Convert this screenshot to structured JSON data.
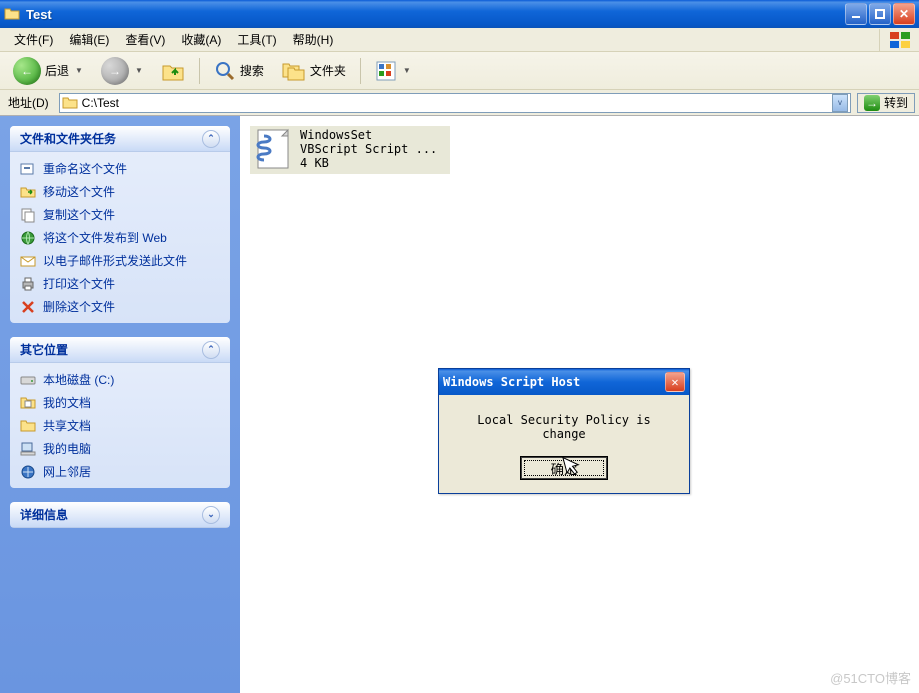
{
  "window": {
    "title": "Test"
  },
  "menu": {
    "file": "文件(F)",
    "edit": "编辑(E)",
    "view": "查看(V)",
    "favorites": "收藏(A)",
    "tools": "工具(T)",
    "help": "帮助(H)"
  },
  "toolbar": {
    "back": "后退",
    "search": "搜索",
    "folders": "文件夹"
  },
  "address": {
    "label": "地址(D)",
    "value": "C:\\Test",
    "go": "转到"
  },
  "sidebar": {
    "tasks_header": "文件和文件夹任务",
    "tasks": [
      "重命名这个文件",
      "移动这个文件",
      "复制这个文件",
      "将这个文件发布到 Web",
      "以电子邮件形式发送此文件",
      "打印这个文件",
      "删除这个文件"
    ],
    "places_header": "其它位置",
    "places": [
      "本地磁盘 (C:)",
      "我的文档",
      "共享文档",
      "我的电脑",
      "网上邻居"
    ],
    "details_header": "详细信息"
  },
  "file": {
    "name": "WindowsSet",
    "type": "VBScript Script ...",
    "size": "4 KB"
  },
  "dialog": {
    "title": "Windows Script Host",
    "message": "Local Security Policy is change",
    "ok": "确定"
  },
  "watermark": "@51CTO博客"
}
